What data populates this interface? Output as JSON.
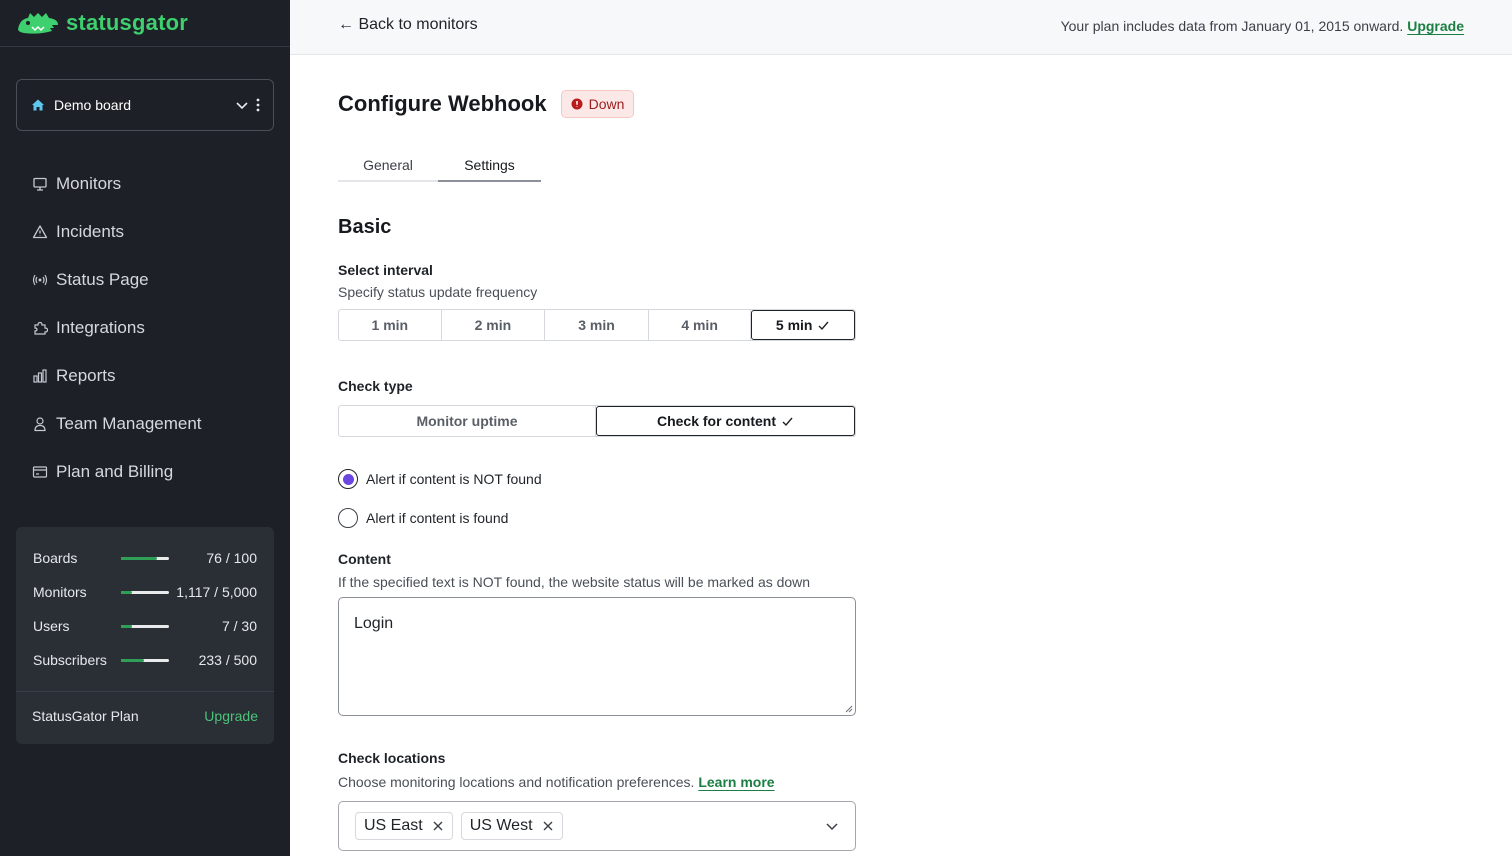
{
  "brand": {
    "name": "statusgator",
    "color": "#3ecf6e"
  },
  "board": {
    "name": "Demo board"
  },
  "nav": [
    {
      "label": "Monitors",
      "icon": "monitor-icon"
    },
    {
      "label": "Incidents",
      "icon": "warning-triangle-icon"
    },
    {
      "label": "Status Page",
      "icon": "broadcast-icon"
    },
    {
      "label": "Integrations",
      "icon": "puzzle-icon"
    },
    {
      "label": "Reports",
      "icon": "bar-chart-icon"
    },
    {
      "label": "Team Management",
      "icon": "user-icon"
    },
    {
      "label": "Plan and Billing",
      "icon": "credit-card-icon"
    }
  ],
  "usage": [
    {
      "label": "Boards",
      "value": "76 / 100",
      "fraction": 0.76
    },
    {
      "label": "Monitors",
      "value": "1,117 / 5,000",
      "fraction": 0.22
    },
    {
      "label": "Users",
      "value": "7 / 30",
      "fraction": 0.23
    },
    {
      "label": "Subscribers",
      "value": "233 / 500",
      "fraction": 0.47
    }
  ],
  "plan": {
    "label": "StatusGator Plan",
    "upgrade": "Upgrade"
  },
  "topbar": {
    "back": "← Back to monitors",
    "note": "Your plan includes data from January 01, 2015 onward.",
    "upgrade": "Upgrade"
  },
  "page": {
    "title": "Configure Webhook",
    "status": "Down",
    "status_color": "#9b1c1c",
    "tabs": [
      "General",
      "Settings"
    ],
    "active_tab": "Settings",
    "section": "Basic"
  },
  "interval": {
    "label": "Select interval",
    "hint": "Specify status update frequency",
    "options": [
      "1 min",
      "2 min",
      "3 min",
      "4 min",
      "5 min"
    ],
    "selected": "5 min"
  },
  "check_type": {
    "label": "Check type",
    "options": [
      "Monitor uptime",
      "Check for content"
    ],
    "selected": "Check for content"
  },
  "alert": {
    "options": [
      "Alert if content is NOT found",
      "Alert if content is found"
    ],
    "selected": "Alert if content is NOT found",
    "radio_color": "#6b46e0"
  },
  "content": {
    "label": "Content",
    "hint": "If the specified text is NOT found, the website status will be marked as down",
    "value": "Login"
  },
  "locations": {
    "label": "Check locations",
    "hint": "Choose monitoring locations and notification preferences.",
    "learn_more": "Learn more",
    "selected": [
      "US East",
      "US West"
    ]
  }
}
